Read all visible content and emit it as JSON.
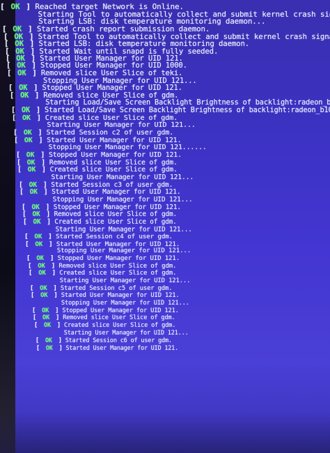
{
  "console": {
    "status_label": "OK",
    "lines": [
      {
        "status": true,
        "text": "Reached target Network is Online."
      },
      {
        "status": false,
        "text": "Starting Tool to automatically collect and submit kernel crash signat"
      },
      {
        "status": false,
        "text": "Starting LSB: disk temperature monitoring daemon..."
      },
      {
        "status": true,
        "text": "Started crash report submission daemon."
      },
      {
        "status": true,
        "text": "Started Tool to automatically collect and submit kernel crash signatur"
      },
      {
        "status": true,
        "text": "Started LSB: disk temperature monitoring daemon."
      },
      {
        "status": true,
        "text": "Started Wait until snapd is fully seeded."
      },
      {
        "status": true,
        "text": "Started User Manager for UID 121."
      },
      {
        "status": true,
        "text": "Stopped User Manager for UID 1000."
      },
      {
        "status": true,
        "text": "Removed slice User Slice of teki."
      },
      {
        "status": false,
        "text": "Stopping User Manager for UID 121..."
      },
      {
        "status": true,
        "text": "Stopped User Manager for UID 121."
      },
      {
        "status": true,
        "text": "Removed slice User Slice of gdm."
      },
      {
        "status": false,
        "text": "Starting Load/Save Screen Backlight Brightness of backlight:radeon_b10.."
      },
      {
        "status": true,
        "text": "Started Load/Save Screen Backlight Brightness of backlight:radeon_b10."
      },
      {
        "status": true,
        "text": "Created slice User Slice of gdm."
      },
      {
        "status": false,
        "text": "Starting User Manager for UID 121..."
      },
      {
        "status": true,
        "text": "Started Session c2 of user gdm."
      },
      {
        "status": true,
        "text": "Started User Manager for UID 121."
      },
      {
        "status": false,
        "text": "Stopping User Manager for UID 121......"
      },
      {
        "status": true,
        "text": "Stopped User Manager for UID 121."
      },
      {
        "status": true,
        "text": "Removed slice User Slice of gdm."
      },
      {
        "status": true,
        "text": "Created slice User Slice of gdm."
      },
      {
        "status": false,
        "text": "Starting User Manager for UID 121..."
      },
      {
        "status": true,
        "text": "Started Session c3 of user gdm."
      },
      {
        "status": true,
        "text": "Started User Manager for UID 121."
      },
      {
        "status": false,
        "text": "Stopping User Manager for UID 121..."
      },
      {
        "status": true,
        "text": "Stopped User Manager for UID 121."
      },
      {
        "status": true,
        "text": "Removed slice User Slice of gdm."
      },
      {
        "status": true,
        "text": "Created slice User Slice of gdm."
      },
      {
        "status": false,
        "text": "Starting User Manager for UID 121..."
      },
      {
        "status": true,
        "text": "Started Session c4 of user gdm."
      },
      {
        "status": true,
        "text": "Started User Manager for UID 121."
      },
      {
        "status": false,
        "text": "Stopping User Manager for UID 121..."
      },
      {
        "status": true,
        "text": "Stopped User Manager for UID 121."
      },
      {
        "status": true,
        "text": "Removed slice User Slice of gdm."
      },
      {
        "status": true,
        "text": "Created slice User Slice of gdm."
      },
      {
        "status": false,
        "text": "Starting User Manager for UID 121..."
      },
      {
        "status": true,
        "text": "Started Session c5 of user gdm."
      },
      {
        "status": true,
        "text": "Started User Manager for UID 121."
      },
      {
        "status": false,
        "text": "Stopping User Manager for UID 121..."
      },
      {
        "status": true,
        "text": "Stopped User Manager for UID 121."
      },
      {
        "status": true,
        "text": "Removed slice User Slice of gdm."
      },
      {
        "status": true,
        "text": "Created slice User Slice of gdm."
      },
      {
        "status": false,
        "text": "Starting User Manager for UID 121..."
      },
      {
        "status": true,
        "text": "Started Session c6 of user gdm."
      },
      {
        "status": true,
        "text": "Started User Manager for UID 121."
      }
    ]
  },
  "colors": {
    "ok_green": "#5dff6c",
    "text": "#eef0ff",
    "screen_blue": "#4336d2"
  }
}
